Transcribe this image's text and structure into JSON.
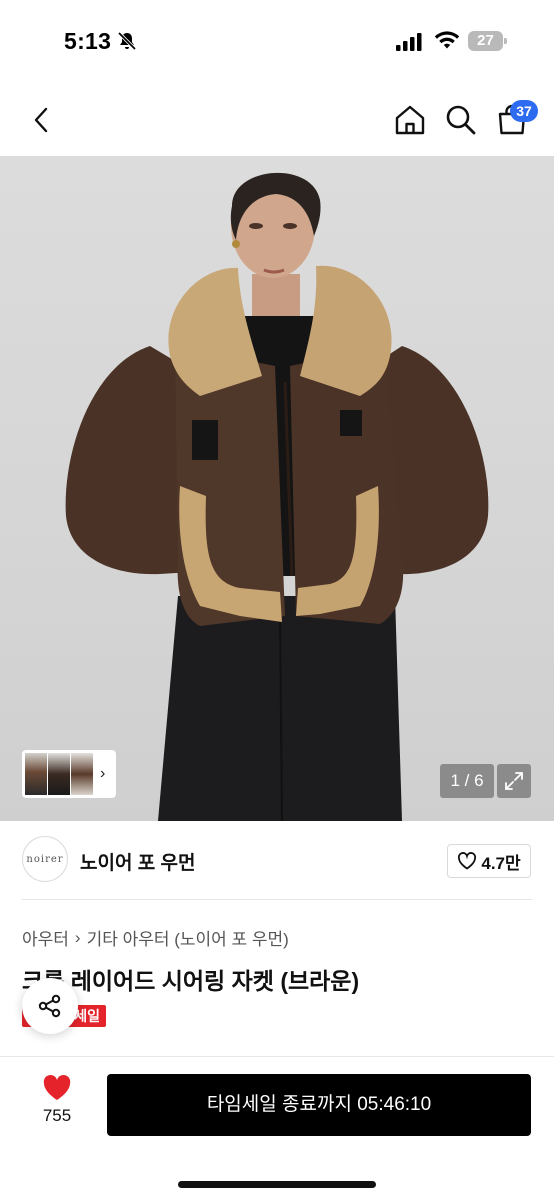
{
  "status_bar": {
    "time": "5:13",
    "battery": "27"
  },
  "nav": {
    "cart_badge": "37"
  },
  "gallery": {
    "page_counter": "1 / 6"
  },
  "seller": {
    "logo_text": "noirer",
    "name": "노이어 포 우먼",
    "likes": "4.7만"
  },
  "breadcrumb": [
    "아우터",
    "기타 아우터 (노이어 포 우먼)"
  ],
  "product": {
    "title": "크롭 레이어드 시어링 자켓 (브라운)",
    "sale_badge": "세일"
  },
  "bottom_bar": {
    "wish_count": "755",
    "buy_label": "타임세일 종료까지 05:46:10"
  },
  "colors": {
    "accent_blue": "#2d6bf0",
    "sale_red": "#e4232b",
    "heart_red": "#e4232b"
  }
}
